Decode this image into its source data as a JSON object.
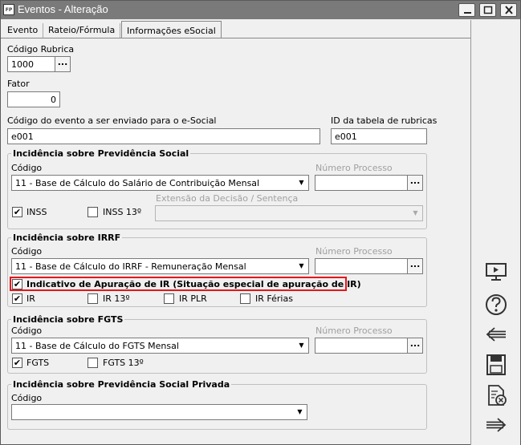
{
  "window": {
    "title": "Eventos - Alteração",
    "app_icon": "FP"
  },
  "tabs": [
    {
      "label": "Evento"
    },
    {
      "label": "Rateio/Fórmula"
    },
    {
      "label": "Informações eSocial"
    }
  ],
  "codigo_rubrica": {
    "label": "Código Rubrica",
    "value": "1000",
    "button": "..."
  },
  "fator": {
    "label": "Fator",
    "value": "0"
  },
  "codigo_evento": {
    "label": "Código do evento a ser enviado para o e-Social",
    "value": "e001"
  },
  "id_tabela": {
    "label": "ID da tabela de rubricas",
    "value": "e001"
  },
  "previdencia": {
    "title": "Incidência sobre Previdência Social",
    "codigo_label": "Código",
    "codigo_value": "11 - Base de Cálculo do Salário de Contribuição Mensal",
    "processo_label": "Número Processo",
    "extensao_label": "Extensão da Decisão / Sentença",
    "inss": {
      "label": "INSS",
      "checked": true
    },
    "inss13": {
      "label": "INSS 13º",
      "checked": false
    }
  },
  "irrf": {
    "title": "Incidência sobre IRRF",
    "codigo_label": "Código",
    "codigo_value": "11 - Base de Cálculo do IRRF - Remuneração Mensal",
    "processo_label": "Número Processo",
    "indicativo": {
      "label": "Indicativo de Apuração de IR (Situação especial de apuração de IR)",
      "checked": true
    },
    "ir": {
      "label": "IR",
      "checked": true
    },
    "ir13": {
      "label": "IR 13º",
      "checked": false
    },
    "irplr": {
      "label": "IR PLR",
      "checked": false
    },
    "irferias": {
      "label": "IR Férias",
      "checked": false
    }
  },
  "fgts": {
    "title": "Incidência sobre FGTS",
    "codigo_label": "Código",
    "codigo_value": "11 - Base de Cálculo do FGTS Mensal",
    "processo_label": "Número Processo",
    "fgts": {
      "label": "FGTS",
      "checked": true
    },
    "fgts13": {
      "label": "FGTS 13º",
      "checked": false
    }
  },
  "privada": {
    "title": "Incidência sobre Previdência Social Privada",
    "codigo_label": "Código",
    "codigo_value": ""
  },
  "sidebar": {
    "icons": [
      "presentation-icon",
      "help-icon",
      "back-arrow-icon",
      "save-icon",
      "cancel-document-icon",
      "forward-arrow-icon"
    ]
  },
  "colors": {
    "titlebar": "#7a7a7a",
    "highlight": "#e8141b"
  },
  "check_glyph": "✔",
  "ellipsis": "...",
  "dropdown_glyph": "▼"
}
